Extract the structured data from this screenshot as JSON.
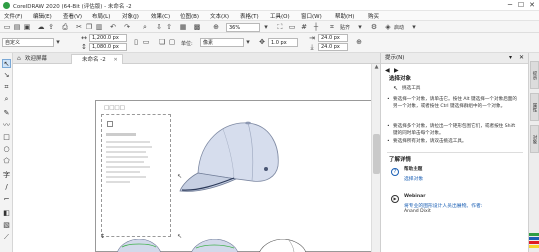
{
  "window": {
    "title": "CorelDRAW 2020 (64-Bit (评估版) - 未命名 -2",
    "min_glyph": "─",
    "max_glyph": "☐",
    "close_glyph": "✕"
  },
  "menu": [
    "文件(F)",
    "编辑(E)",
    "查看(V)",
    "布局(L)",
    "对象(J)",
    "效果(C)",
    "位图(B)",
    "文本(X)",
    "表格(T)",
    "工具(O)",
    "窗口(W)",
    "帮助(H)",
    "购买"
  ],
  "toolbar1": {
    "zoom_value": "36%",
    "snap_label": "贴齐",
    "launch_label": "启动"
  },
  "toolbar2": {
    "preset_value": "自定义",
    "width_value": "1,200.0 px",
    "height_value": "1,080.0 px",
    "units_label": "单位:",
    "units_value": "像素",
    "nudge_value": "1.0 px",
    "dup_x_value": "24.0 px",
    "dup_y_value": "24.0 px"
  },
  "tabs": {
    "welcome": "欢迎屏幕",
    "document": "未命名 -2"
  },
  "panel": {
    "header": "提示(N)",
    "section_title": "选择对象",
    "tool_name": "挑选工具",
    "bullets": [
      "要选择一个对象，请单击它。按住 Alt 键选择一个对象后面的另一个对象，或者按住 Ctrl 键选择群组中的一个对象。",
      "要选择多个对象，请拉出一个矩形包围它们，或者按住 Shift 键的同时单击每个对象。",
      "要选择所有对象，请双击挑选工具。"
    ],
    "learn_more": "了解详情",
    "help_topic": "帮助主题",
    "help_link": "选择对象",
    "webinar_title": "Webinar",
    "webinar_text": "将专业的图形设计人员出展物。作者:",
    "webinar_author": "Anand Dixit"
  },
  "side_tabs": [
    "提示",
    "属性",
    "对象"
  ],
  "page_placeholder": "□□□□",
  "colors": {
    "accent": "#2f9e44",
    "selection": "#7aa8d6",
    "cap_body": "#cfd7e6",
    "cap_shadow": "#8c9ab2"
  }
}
